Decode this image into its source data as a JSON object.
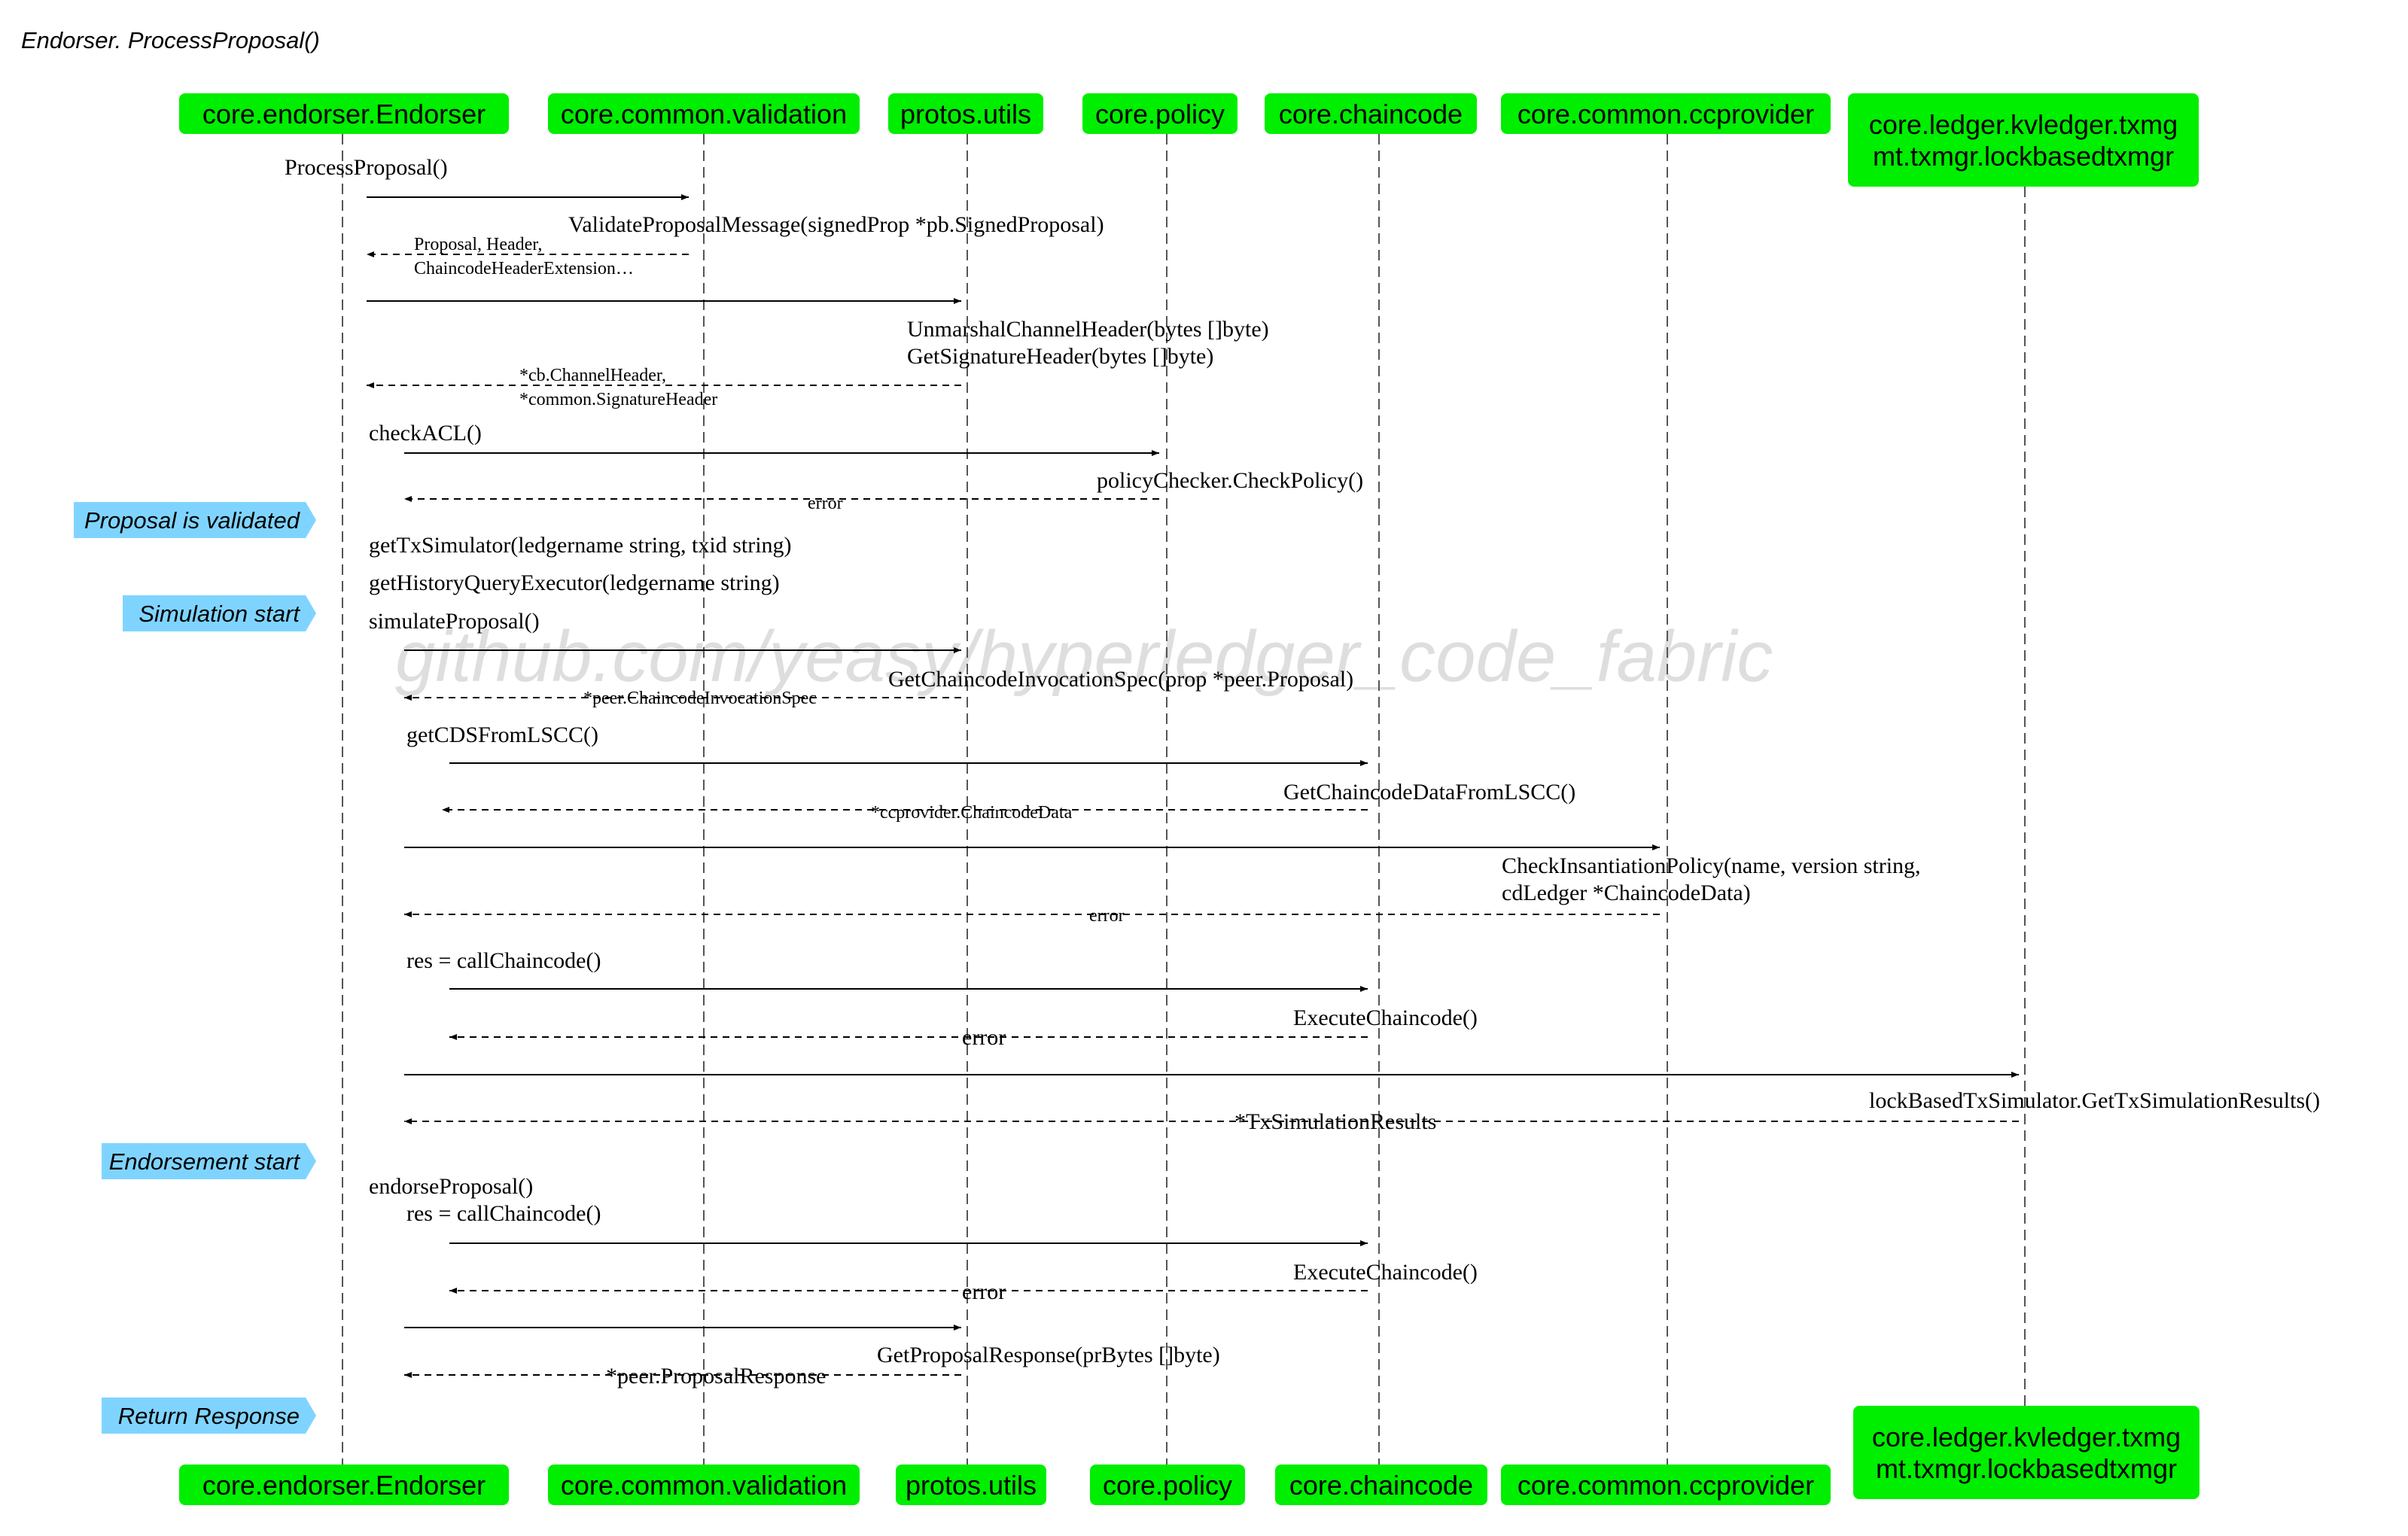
{
  "title": "Endorser. ProcessProposal()",
  "watermark": "github.com/yeasy/hyperledger_code_fabric",
  "colors": {
    "participant_fill": "#00ee00",
    "note_fill": "#7fd4ff",
    "line": "#000000",
    "lifeline": "#555555",
    "watermark": "#d9d9d9"
  },
  "participants": [
    {
      "id": "endorser",
      "label_lines": [
        "core.endorser.Endorser"
      ]
    },
    {
      "id": "validation",
      "label_lines": [
        "core.common.validation"
      ]
    },
    {
      "id": "utils",
      "label_lines": [
        "protos.utils"
      ]
    },
    {
      "id": "policy",
      "label_lines": [
        "core.policy"
      ]
    },
    {
      "id": "chaincode",
      "label_lines": [
        "core.chaincode"
      ]
    },
    {
      "id": "ccprovider",
      "label_lines": [
        "core.common.ccprovider"
      ]
    },
    {
      "id": "txmgr",
      "label_lines": [
        "core.ledger.kvledger.txmg",
        "mt.txmgr.lockbasedtxmgr"
      ]
    }
  ],
  "notes": [
    {
      "id": "validated",
      "text": "Proposal is validated"
    },
    {
      "id": "simulation",
      "text": "Simulation start"
    },
    {
      "id": "endorsement",
      "text": "Endorsement start"
    },
    {
      "id": "return",
      "text": "Return Response"
    }
  ],
  "messages": [
    {
      "id": "m1",
      "label_lines": [
        "ProcessProposal()"
      ]
    },
    {
      "id": "m2",
      "label_lines": [
        "ValidateProposalMessage(signedProp *pb.SignedProposal)"
      ]
    },
    {
      "id": "m3",
      "label_lines": [
        "Proposal, Header,",
        "ChaincodeHeaderExtension…"
      ]
    },
    {
      "id": "m4",
      "label_lines": [
        "UnmarshalChannelHeader(bytes []byte)",
        "GetSignatureHeader(bytes []byte)"
      ]
    },
    {
      "id": "m5",
      "label_lines": [
        "*cb.ChannelHeader,",
        "*common.SignatureHeader"
      ]
    },
    {
      "id": "m6",
      "label_lines": [
        "checkACL()"
      ]
    },
    {
      "id": "m7",
      "label_lines": [
        "policyChecker.CheckPolicy()"
      ]
    },
    {
      "id": "m8",
      "label_lines": [
        "error"
      ]
    },
    {
      "id": "m9",
      "label_lines": [
        "getTxSimulator(ledgername string, txid string)"
      ]
    },
    {
      "id": "m10",
      "label_lines": [
        "getHistoryQueryExecutor(ledgername string)"
      ]
    },
    {
      "id": "m11",
      "label_lines": [
        "simulateProposal()"
      ]
    },
    {
      "id": "m12",
      "label_lines": [
        "GetChaincodeInvocationSpec(prop *peer.Proposal)"
      ]
    },
    {
      "id": "m13",
      "label_lines": [
        "*peer.ChaincodeInvocationSpec"
      ]
    },
    {
      "id": "m14",
      "label_lines": [
        "getCDSFromLSCC()"
      ]
    },
    {
      "id": "m15",
      "label_lines": [
        "GetChaincodeDataFromLSCC()"
      ]
    },
    {
      "id": "m16",
      "label_lines": [
        "*ccprovider.ChaincodeData"
      ]
    },
    {
      "id": "m17",
      "label_lines": [
        "CheckInsantiationPolicy(name, version string,",
        "cdLedger *ChaincodeData)"
      ]
    },
    {
      "id": "m18",
      "label_lines": [
        "error"
      ]
    },
    {
      "id": "m19",
      "label_lines": [
        "res = callChaincode()"
      ]
    },
    {
      "id": "m20",
      "label_lines": [
        "ExecuteChaincode()"
      ]
    },
    {
      "id": "m21",
      "label_lines": [
        "error"
      ]
    },
    {
      "id": "m22",
      "label_lines": [
        "lockBasedTxSimulator.GetTxSimulationResults()"
      ]
    },
    {
      "id": "m23",
      "label_lines": [
        "*TxSimulationResults"
      ]
    },
    {
      "id": "m24",
      "label_lines": [
        "endorseProposal()"
      ]
    },
    {
      "id": "m25",
      "label_lines": [
        "res = callChaincode()"
      ]
    },
    {
      "id": "m26",
      "label_lines": [
        "ExecuteChaincode()"
      ]
    },
    {
      "id": "m27",
      "label_lines": [
        "error"
      ]
    },
    {
      "id": "m28",
      "label_lines": [
        "GetProposalResponse(prBytes []byte)"
      ]
    },
    {
      "id": "m29",
      "label_lines": [
        "*peer.ProposalResponse"
      ]
    }
  ]
}
